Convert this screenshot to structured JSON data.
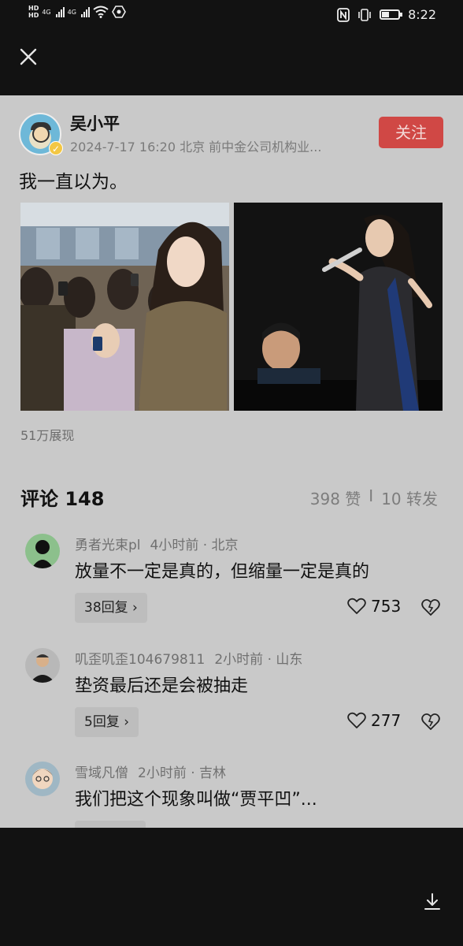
{
  "status_bar": {
    "hd1": "HD",
    "hd2": "HD",
    "net1": "4G",
    "net2": "4G",
    "time": "8:22"
  },
  "post": {
    "author": "吴小平",
    "meta": "2024-7-17 16:20  北京  前中金公司机构业...",
    "follow_label": "关注",
    "text": "我一直以为。",
    "views": "51万展现"
  },
  "comments_section": {
    "title": "评论 148",
    "likes": "398 赞",
    "separator": "I",
    "shares": "10 转发"
  },
  "comments": [
    {
      "user": "勇者光束pl",
      "time": "4小时前 · 北京",
      "text": "放量不一定是真的，但缩量一定是真的",
      "replies": "38回复",
      "likes": "753"
    },
    {
      "user": "叽歪叽歪104679811",
      "time": "2小时前 · 山东",
      "text": "垫资最后还是会被抽走",
      "replies": "5回复",
      "likes": "277"
    },
    {
      "user": "雪域凡僧",
      "time": "2小时前 · 吉林",
      "text": "我们把这个现象叫做“贾平凹”..."
    }
  ],
  "icons": {
    "close": "close-icon",
    "download": "download-icon",
    "heart": "heart-icon",
    "dislike": "broken-heart-icon"
  },
  "colors": {
    "follow_button": "#d04845",
    "card_background": "#c9c9c9",
    "page_background": "#121212"
  }
}
